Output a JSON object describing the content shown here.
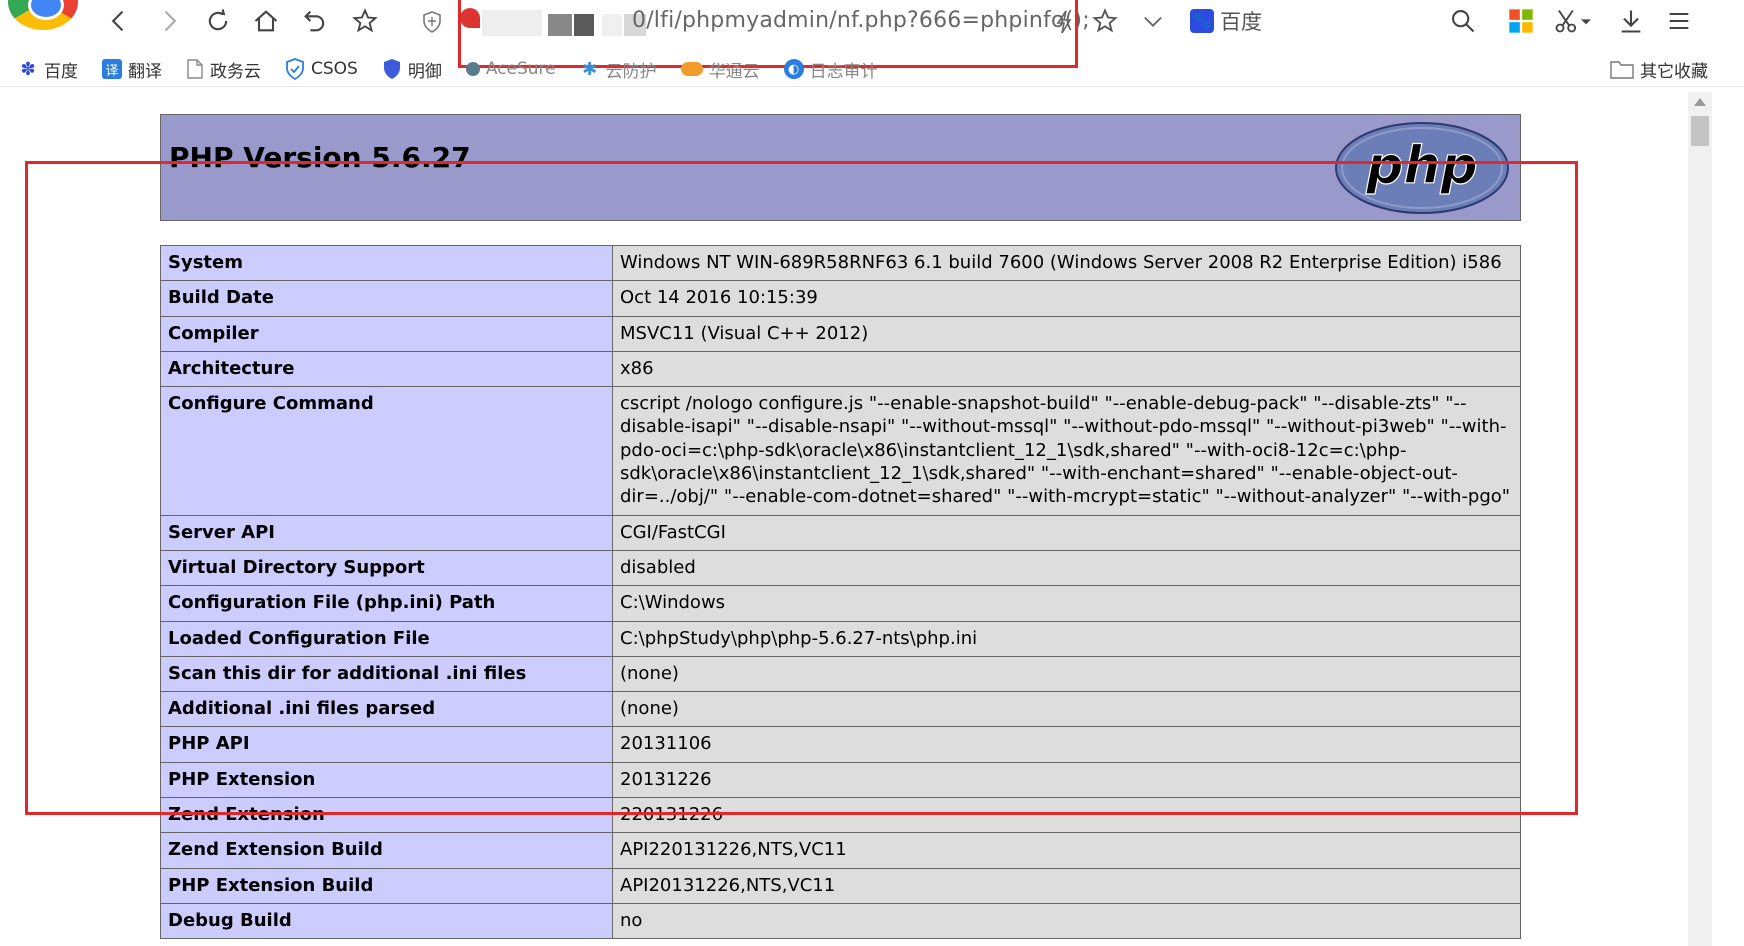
{
  "browser": {
    "address_url": "0/lfi/phpmyadmin/nf.php?666=phpinfo();",
    "search_engine": "百度",
    "icons": [
      "back-icon",
      "forward-icon",
      "reload-icon",
      "home-icon",
      "undo-icon",
      "star-icon",
      "shield-icon",
      "bolt-icon",
      "star-icon",
      "chevron-down-icon",
      "search-icon",
      "apps-icon",
      "scissors-icon",
      "download-icon",
      "menu-icon"
    ]
  },
  "bookmarks": [
    {
      "label": "百度",
      "icon": "paw-icon"
    },
    {
      "label": "翻译",
      "icon": "translate-icon"
    },
    {
      "label": "政务云",
      "icon": "page-icon"
    },
    {
      "label": "CSOS",
      "icon": "shield-icon"
    },
    {
      "label": "明御",
      "icon": "shield-icon"
    },
    {
      "label": "AceSure",
      "icon": "ace-icon"
    },
    {
      "label": "云防护",
      "icon": "bug-icon"
    },
    {
      "label": "华通云",
      "icon": "cloud-icon"
    },
    {
      "label": "日志审计",
      "icon": "log-icon"
    }
  ],
  "other_bookmarks": "其它收藏",
  "php": {
    "title": "PHP Version 5.6.27",
    "logo": "php",
    "rows": [
      {
        "key": "System",
        "value": "Windows NT WIN-689R58RNF63 6.1 build 7600 (Windows Server 2008 R2 Enterprise Edition) i586"
      },
      {
        "key": "Build Date",
        "value": "Oct 14 2016 10:15:39"
      },
      {
        "key": "Compiler",
        "value": "MSVC11 (Visual C++ 2012)"
      },
      {
        "key": "Architecture",
        "value": "x86"
      },
      {
        "key": "Configure Command",
        "value": "cscript /nologo configure.js \"--enable-snapshot-build\" \"--enable-debug-pack\" \"--disable-zts\" \"--disable-isapi\" \"--disable-nsapi\" \"--without-mssql\" \"--without-pdo-mssql\" \"--without-pi3web\" \"--with-pdo-oci=c:\\php-sdk\\oracle\\x86\\instantclient_12_1\\sdk,shared\" \"--with-oci8-12c=c:\\php-sdk\\oracle\\x86\\instantclient_12_1\\sdk,shared\" \"--with-enchant=shared\" \"--enable-object-out-dir=../obj/\" \"--enable-com-dotnet=shared\" \"--with-mcrypt=static\" \"--without-analyzer\" \"--with-pgo\""
      },
      {
        "key": "Server API",
        "value": "CGI/FastCGI"
      },
      {
        "key": "Virtual Directory Support",
        "value": "disabled"
      },
      {
        "key": "Configuration File (php.ini) Path",
        "value": "C:\\Windows"
      },
      {
        "key": "Loaded Configuration File",
        "value": "C:\\phpStudy\\php\\php-5.6.27-nts\\php.ini"
      },
      {
        "key": "Scan this dir for additional .ini files",
        "value": "(none)"
      },
      {
        "key": "Additional .ini files parsed",
        "value": "(none)"
      },
      {
        "key": "PHP API",
        "value": "20131106"
      },
      {
        "key": "PHP Extension",
        "value": "20131226"
      },
      {
        "key": "Zend Extension",
        "value": "220131226"
      },
      {
        "key": "Zend Extension Build",
        "value": "API220131226,NTS,VC11"
      },
      {
        "key": "PHP Extension Build",
        "value": "API20131226,NTS,VC11"
      },
      {
        "key": "Debug Build",
        "value": "no"
      }
    ]
  },
  "colors": {
    "annotation_red": "#e0292a",
    "php_header": "#9999cc",
    "key_cell": "#ccccff",
    "value_cell": "#dddddd"
  }
}
